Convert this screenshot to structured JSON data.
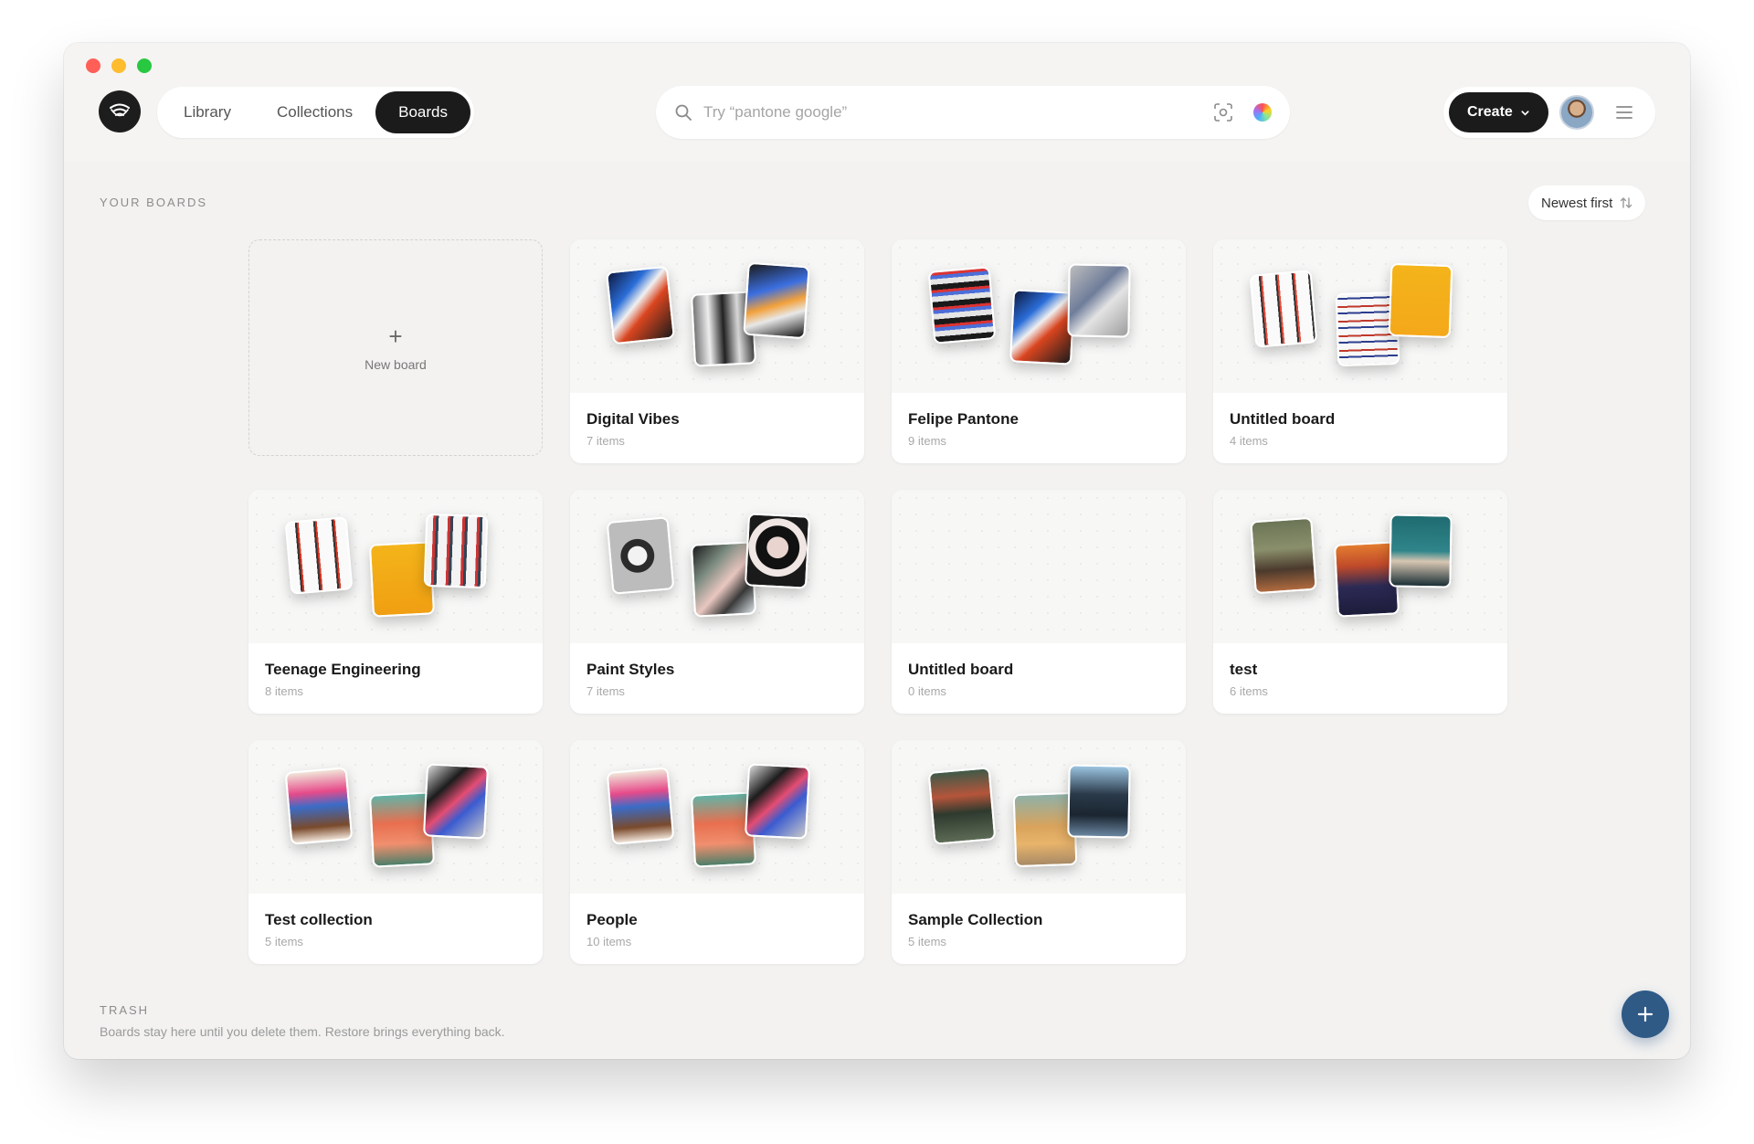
{
  "window": {
    "controls": [
      "close",
      "minimize",
      "zoom"
    ]
  },
  "nav": {
    "tabs": [
      {
        "label": "Library",
        "active": false
      },
      {
        "label": "Collections",
        "active": false
      },
      {
        "label": "Boards",
        "active": true
      }
    ]
  },
  "search": {
    "placeholder": "Try “pantone google”",
    "icon": "search-icon",
    "visual_search_icon": "scan-icon",
    "color_filter_icon": "color-orb-icon"
  },
  "toolbar": {
    "create_label": "Create",
    "menu_icon": "hamburger-menu-icon"
  },
  "boards_section": {
    "heading": "YOUR BOARDS",
    "sort_label": "Newest first",
    "new_board_label": "New board",
    "boards": [
      {
        "title": "Digital Vibes",
        "count": "7 items"
      },
      {
        "title": "Felipe Pantone",
        "count": "9 items"
      },
      {
        "title": "Untitled board",
        "count": "4 items"
      },
      {
        "title": "Teenage Engineering",
        "count": "8 items"
      },
      {
        "title": "Paint Styles",
        "count": "7 items"
      },
      {
        "title": "Untitled board",
        "count": "0 items"
      },
      {
        "title": "test",
        "count": "6 items"
      },
      {
        "title": "Test collection",
        "count": "5 items"
      },
      {
        "title": "People",
        "count": "10 items"
      },
      {
        "title": "Sample Collection",
        "count": "5 items"
      }
    ]
  },
  "trash": {
    "heading": "TRASH",
    "description": "Boards stay here until you delete them. Restore brings everything back."
  },
  "colors": {
    "accent_dark": "#1b1b1b",
    "fab_blue": "#2f5a86",
    "background": "#f3f2f1"
  }
}
